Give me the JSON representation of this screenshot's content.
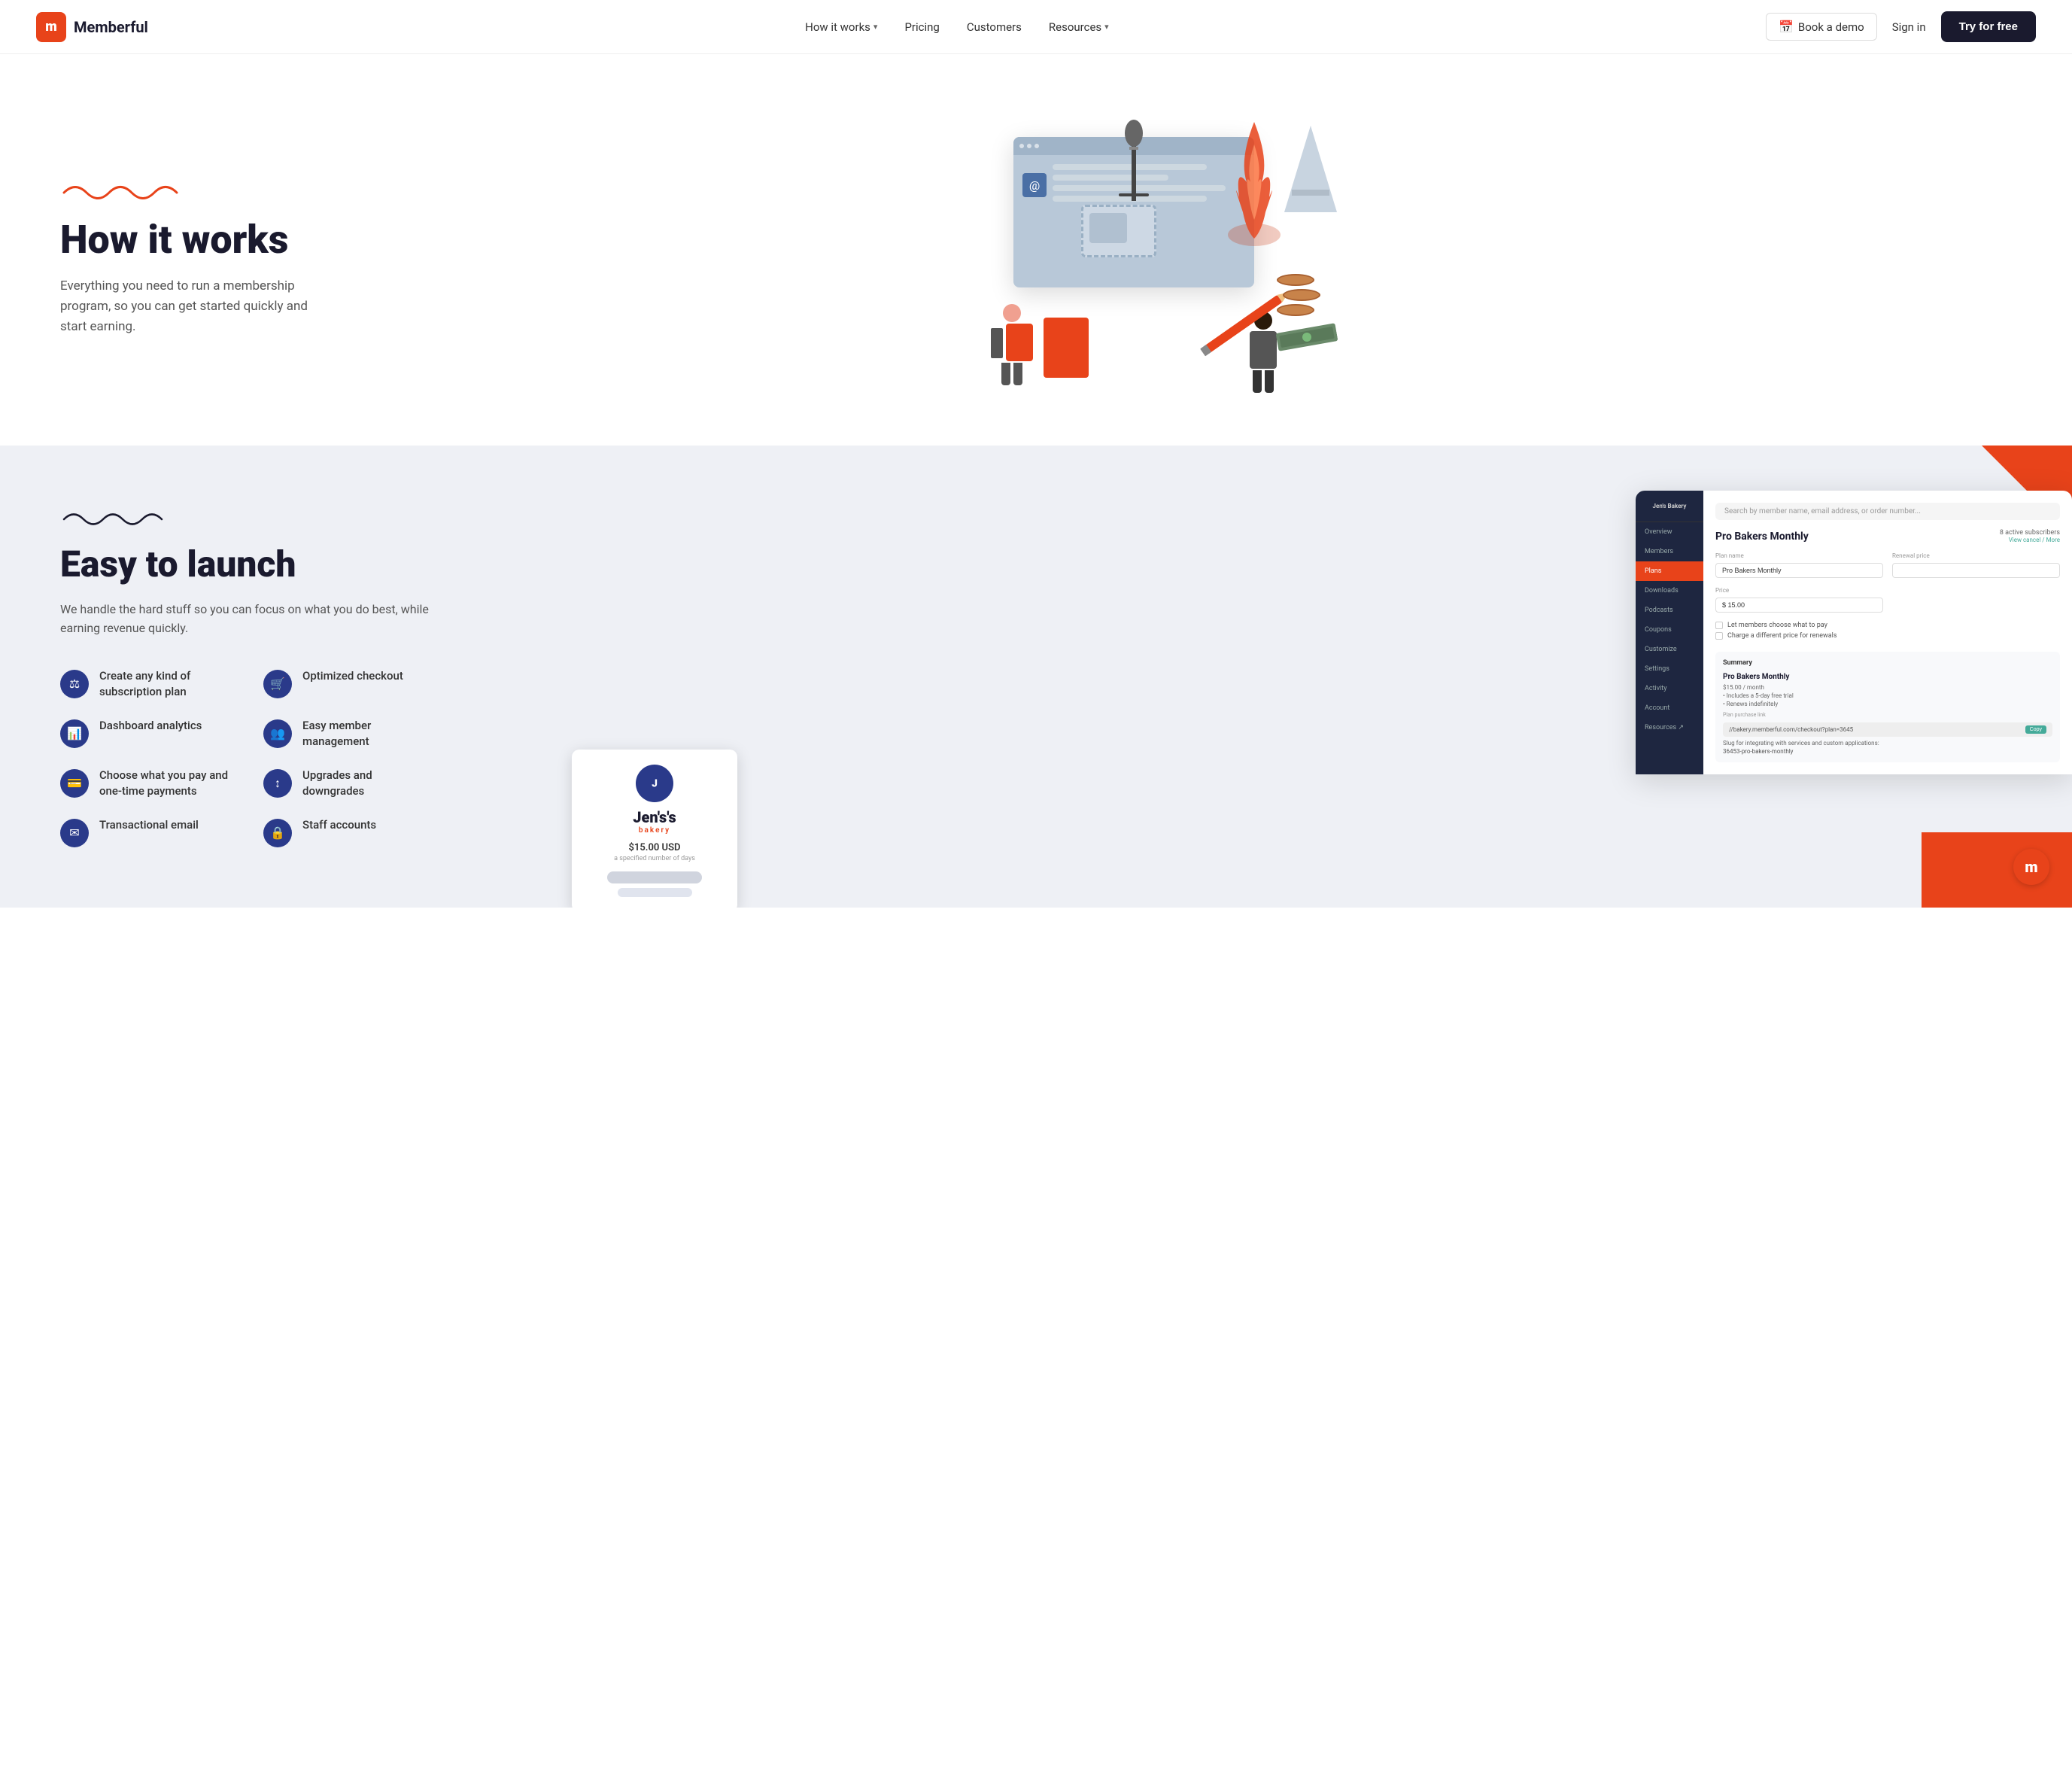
{
  "nav": {
    "logo_initial": "m",
    "logo_text": "Memberful",
    "links": [
      {
        "id": "how-it-works",
        "label": "How it works",
        "has_dropdown": true
      },
      {
        "id": "pricing",
        "label": "Pricing",
        "has_dropdown": false
      },
      {
        "id": "customers",
        "label": "Customers",
        "has_dropdown": false
      },
      {
        "id": "resources",
        "label": "Resources",
        "has_dropdown": true
      }
    ],
    "book_demo": "Book a demo",
    "sign_in": "Sign in",
    "try_free": "Try for free"
  },
  "hero": {
    "squiggle_color": "#e8431a",
    "title": "How it works",
    "subtitle": "Everything you need to run a membership program, so you can get started quickly and start earning."
  },
  "launch": {
    "squiggle_color": "#1a1a2e",
    "title": "Easy to launch",
    "subtitle": "We handle the hard stuff so you can focus on what you do best, while earning revenue quickly.",
    "features": [
      {
        "id": "subscription-plan",
        "icon": "⚖",
        "text": "Create any kind of subscription plan"
      },
      {
        "id": "optimized-checkout",
        "icon": "🛒",
        "text": "Optimized checkout"
      },
      {
        "id": "dashboard-analytics",
        "icon": "📊",
        "text": "Dashboard analytics"
      },
      {
        "id": "member-management",
        "icon": "👥",
        "text": "Easy member management"
      },
      {
        "id": "payment-options",
        "icon": "💳",
        "text": "Choose what you pay and one-time payments"
      },
      {
        "id": "upgrades-downgrades",
        "icon": "↕",
        "text": "Upgrades and downgrades"
      },
      {
        "id": "transactional-email",
        "icon": "✉",
        "text": "Transactional email"
      },
      {
        "id": "staff-accounts",
        "icon": "🔒",
        "text": "Staff accounts"
      }
    ]
  },
  "dashboard": {
    "site_name": "Jen's Bakery",
    "sidebar_items": [
      {
        "id": "overview",
        "label": "Overview",
        "active": false
      },
      {
        "id": "members",
        "label": "Members",
        "active": false
      },
      {
        "id": "plans",
        "label": "Plans",
        "active": true
      },
      {
        "id": "downloads",
        "label": "Downloads",
        "active": false
      },
      {
        "id": "podcasts",
        "label": "Podcasts",
        "active": false
      },
      {
        "id": "coupons",
        "label": "Coupons",
        "active": false
      },
      {
        "id": "customize",
        "label": "Customize",
        "active": false
      },
      {
        "id": "settings",
        "label": "Settings",
        "active": false
      },
      {
        "id": "activity",
        "label": "Activity",
        "active": false
      },
      {
        "id": "account",
        "label": "Account",
        "active": false
      },
      {
        "id": "resources",
        "label": "Resources ↗",
        "active": false
      }
    ],
    "search_placeholder": "Search by member name, email address, or order number...",
    "plan_title": "Pro Bakers Monthly",
    "subscriber_count": "8 active subscribers",
    "view_cancel": "View cancel / More",
    "form": {
      "plan_name_label": "Plan name",
      "plan_name_value": "Pro Bakers Monthly",
      "price_label": "Price",
      "price_value": "$ 15.00",
      "renewal_label": "Renewal price",
      "checkboxes": [
        "Let members choose what to pay",
        "Charge a different price for renewals"
      ]
    },
    "summary": {
      "title": "Summary",
      "plan_name": "Pro Bakers Monthly",
      "price": "$15.00 / month",
      "features": [
        "• Includes a 5-day free trial",
        "• Renews indefinitely"
      ],
      "purchase_link_label": "Plan purchase link",
      "url": "//bakery.memberful.com/checkout?plan=3645",
      "copy_btn": "Copy",
      "slug_label": "Slug for integrating with services and custom applications:",
      "slug": "36453-pro-bakers-monthly"
    }
  },
  "checkout": {
    "bakery_name": "Jen's",
    "bakery_sub": "bakery",
    "price": "$15.00 USD",
    "days_text": "a specified number of days"
  },
  "memberful_badge": "m"
}
